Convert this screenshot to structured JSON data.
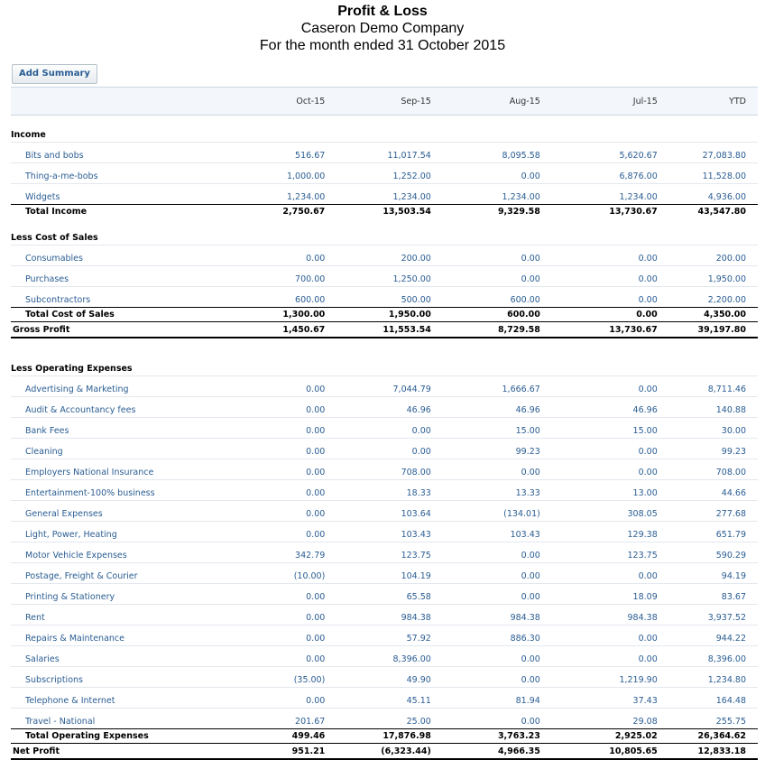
{
  "report": {
    "title": "Profit & Loss",
    "company": "Caseron Demo Company",
    "period": "For the month ended 31 October 2015"
  },
  "toolbar": {
    "add_summary_label": "Add Summary"
  },
  "columns": [
    "Oct-15",
    "Sep-15",
    "Aug-15",
    "Jul-15",
    "YTD"
  ],
  "income": {
    "heading": "Income",
    "rows": [
      {
        "label": "Bits and bobs",
        "values": [
          "516.67",
          "11,017.54",
          "8,095.58",
          "5,620.67",
          "27,083.80"
        ]
      },
      {
        "label": "Thing-a-me-bobs",
        "values": [
          "1,000.00",
          "1,252.00",
          "0.00",
          "6,876.00",
          "11,528.00"
        ]
      },
      {
        "label": "Widgets",
        "values": [
          "1,234.00",
          "1,234.00",
          "1,234.00",
          "1,234.00",
          "4,936.00"
        ]
      }
    ],
    "total": {
      "label": "Total Income",
      "values": [
        "2,750.67",
        "13,503.54",
        "9,329.58",
        "13,730.67",
        "43,547.80"
      ]
    }
  },
  "cost_of_sales": {
    "heading": "Less Cost of Sales",
    "rows": [
      {
        "label": "Consumables",
        "values": [
          "0.00",
          "200.00",
          "0.00",
          "0.00",
          "200.00"
        ]
      },
      {
        "label": "Purchases",
        "values": [
          "700.00",
          "1,250.00",
          "0.00",
          "0.00",
          "1,950.00"
        ]
      },
      {
        "label": "Subcontractors",
        "values": [
          "600.00",
          "500.00",
          "600.00",
          "0.00",
          "2,200.00"
        ]
      }
    ],
    "total": {
      "label": "Total Cost of Sales",
      "values": [
        "1,300.00",
        "1,950.00",
        "600.00",
        "0.00",
        "4,350.00"
      ]
    }
  },
  "gross_profit": {
    "label": "Gross Profit",
    "values": [
      "1,450.67",
      "11,553.54",
      "8,729.58",
      "13,730.67",
      "39,197.80"
    ]
  },
  "operating_expenses": {
    "heading": "Less Operating Expenses",
    "rows": [
      {
        "label": "Advertising & Marketing",
        "values": [
          "0.00",
          "7,044.79",
          "1,666.67",
          "0.00",
          "8,711.46"
        ]
      },
      {
        "label": "Audit & Accountancy fees",
        "values": [
          "0.00",
          "46.96",
          "46.96",
          "46.96",
          "140.88"
        ]
      },
      {
        "label": "Bank Fees",
        "values": [
          "0.00",
          "0.00",
          "15.00",
          "15.00",
          "30.00"
        ]
      },
      {
        "label": "Cleaning",
        "values": [
          "0.00",
          "0.00",
          "99.23",
          "0.00",
          "99.23"
        ]
      },
      {
        "label": "Employers National Insurance",
        "values": [
          "0.00",
          "708.00",
          "0.00",
          "0.00",
          "708.00"
        ]
      },
      {
        "label": "Entertainment-100% business",
        "values": [
          "0.00",
          "18.33",
          "13.33",
          "13.00",
          "44.66"
        ]
      },
      {
        "label": "General Expenses",
        "values": [
          "0.00",
          "103.64",
          "(134.01)",
          "308.05",
          "277.68"
        ]
      },
      {
        "label": "Light, Power, Heating",
        "values": [
          "0.00",
          "103.43",
          "103.43",
          "129.38",
          "651.79"
        ]
      },
      {
        "label": "Motor Vehicle Expenses",
        "values": [
          "342.79",
          "123.75",
          "0.00",
          "123.75",
          "590.29"
        ]
      },
      {
        "label": "Postage, Freight & Courier",
        "values": [
          "(10.00)",
          "104.19",
          "0.00",
          "0.00",
          "94.19"
        ]
      },
      {
        "label": "Printing & Stationery",
        "values": [
          "0.00",
          "65.58",
          "0.00",
          "18.09",
          "83.67"
        ]
      },
      {
        "label": "Rent",
        "values": [
          "0.00",
          "984.38",
          "984.38",
          "984.38",
          "3,937.52"
        ]
      },
      {
        "label": "Repairs & Maintenance",
        "values": [
          "0.00",
          "57.92",
          "886.30",
          "0.00",
          "944.22"
        ]
      },
      {
        "label": "Salaries",
        "values": [
          "0.00",
          "8,396.00",
          "0.00",
          "0.00",
          "8,396.00"
        ]
      },
      {
        "label": "Subscriptions",
        "values": [
          "(35.00)",
          "49.90",
          "0.00",
          "1,219.90",
          "1,234.80"
        ]
      },
      {
        "label": "Telephone & Internet",
        "values": [
          "0.00",
          "45.11",
          "81.94",
          "37.43",
          "164.48"
        ]
      },
      {
        "label": "Travel - National",
        "values": [
          "201.67",
          "25.00",
          "0.00",
          "29.08",
          "255.75"
        ]
      }
    ],
    "total": {
      "label": "Total Operating Expenses",
      "values": [
        "499.46",
        "17,876.98",
        "3,763.23",
        "2,925.02",
        "26,364.62"
      ]
    }
  },
  "net_profit": {
    "label": "Net Profit",
    "values": [
      "951.21",
      "(6,323.44)",
      "4,966.35",
      "10,805.65",
      "12,833.18"
    ]
  }
}
